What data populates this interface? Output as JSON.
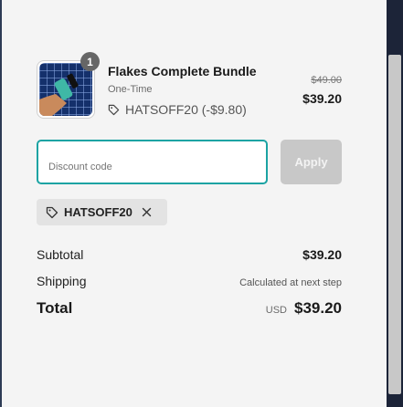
{
  "product": {
    "quantity": "1",
    "title": "Flakes Complete Bundle",
    "purchase_type": "One-Time",
    "discount_line": "HATSOFF20 (-$9.80)",
    "original_price": "$49.00",
    "price": "$39.20"
  },
  "discount": {
    "placeholder": "Discount code",
    "apply_label": "Apply",
    "applied_code": "HATSOFF20"
  },
  "summary": {
    "subtotal_label": "Subtotal",
    "subtotal_value": "$39.20",
    "shipping_label": "Shipping",
    "shipping_value": "Calculated at next step",
    "total_label": "Total",
    "currency": "USD",
    "total_value": "$39.20"
  },
  "colors": {
    "accent": "#1ba3a3",
    "background": "#f4f4f4",
    "scrollbar_track": "#1c2438"
  }
}
